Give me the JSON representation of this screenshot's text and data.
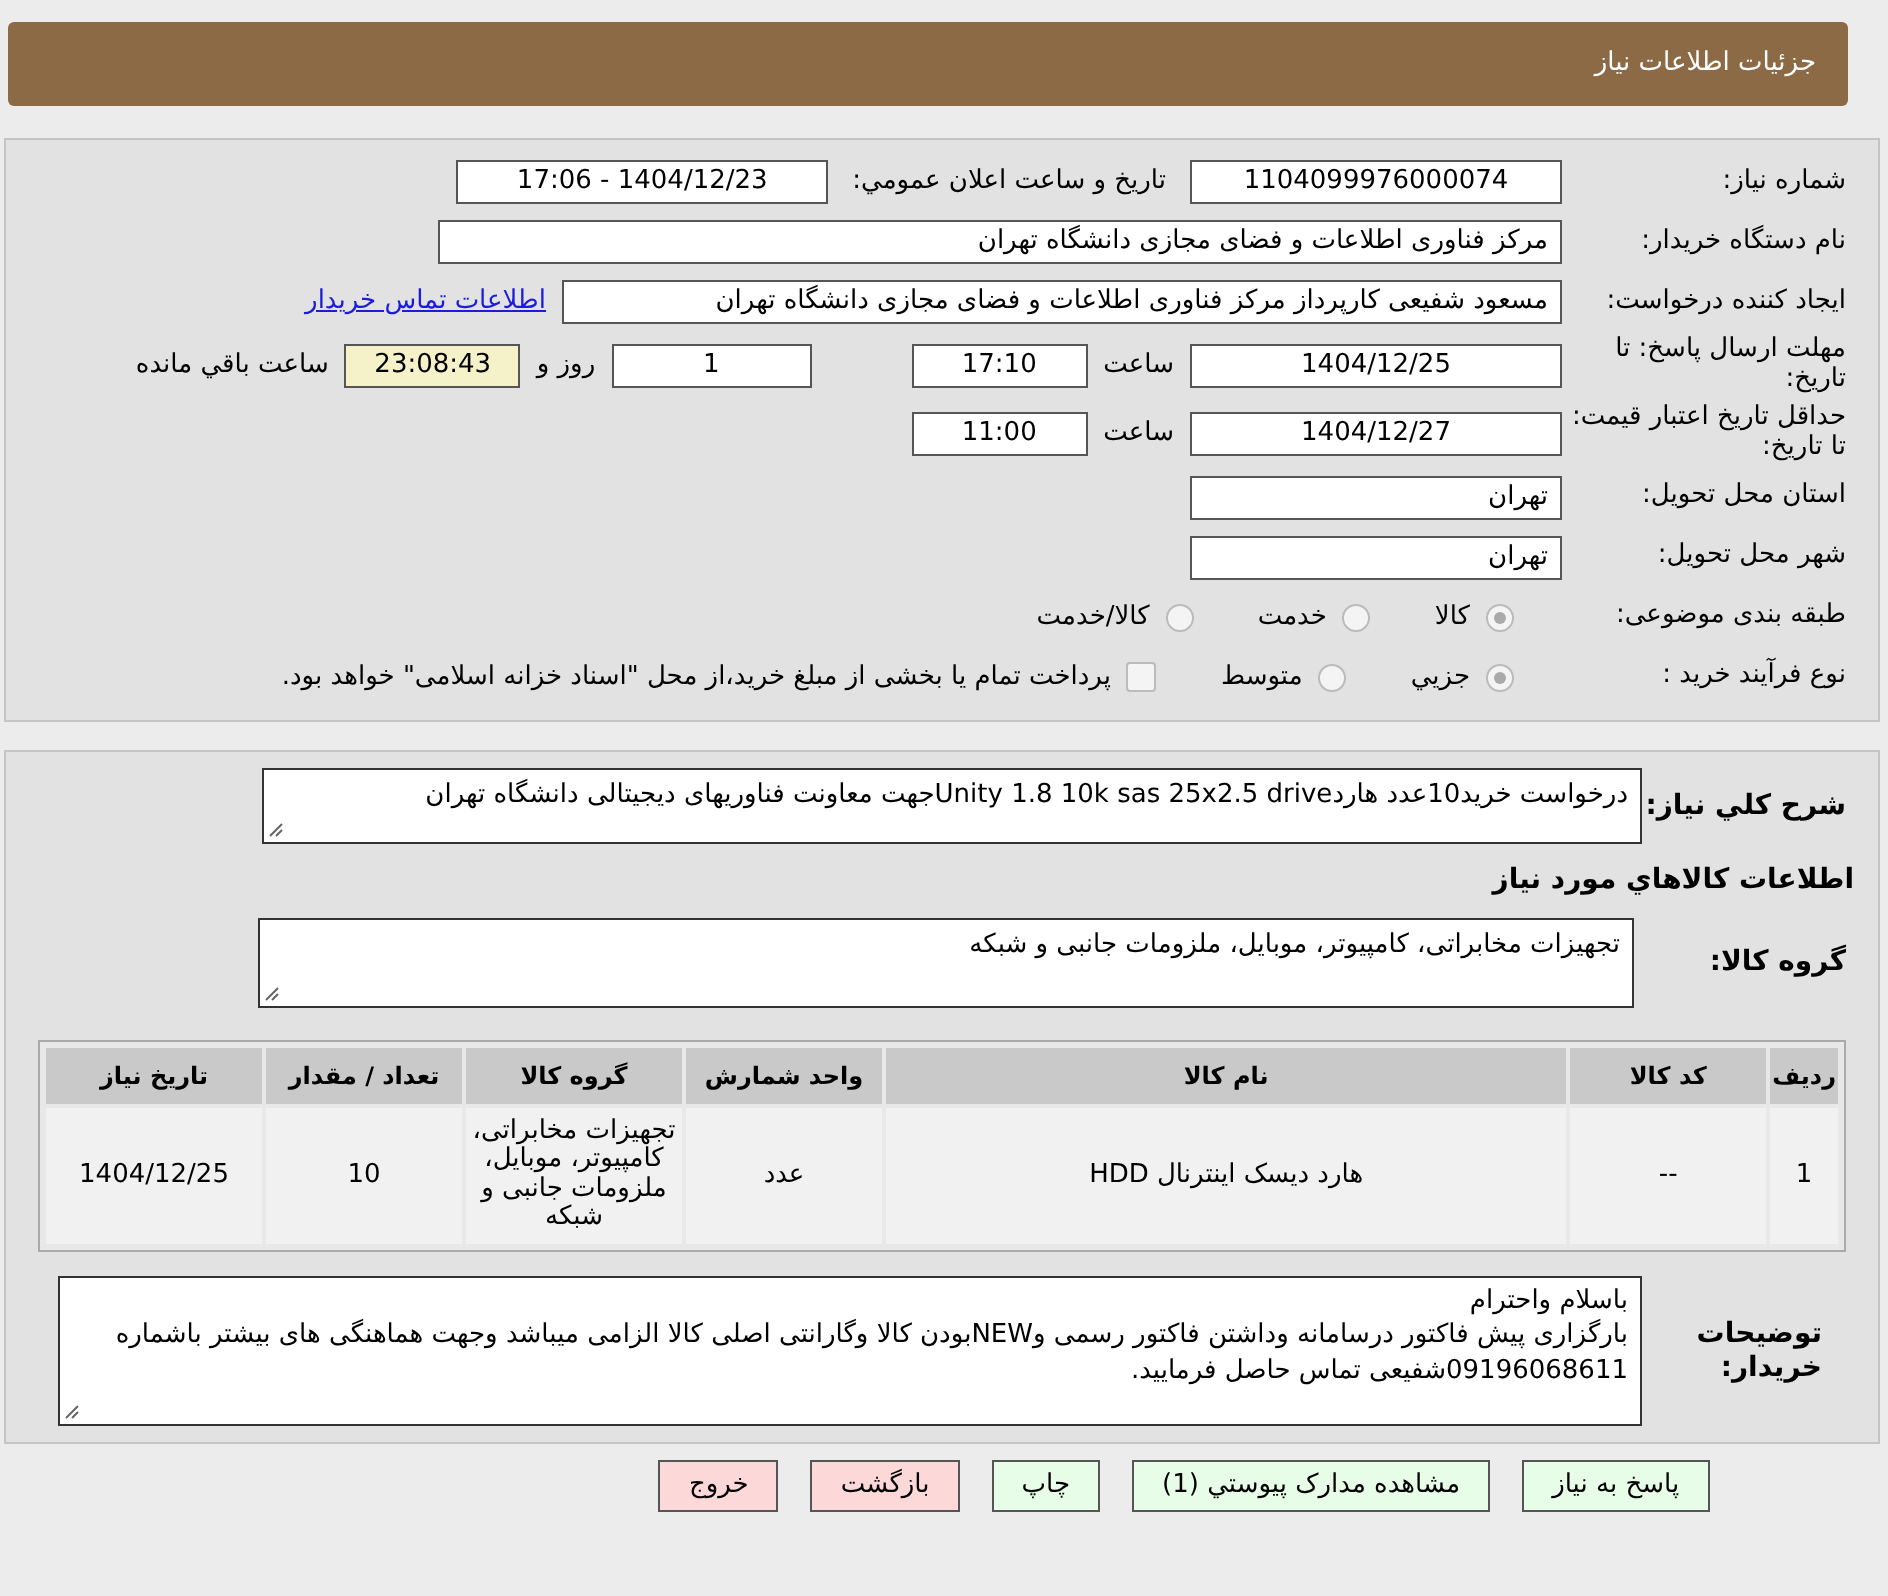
{
  "header": {
    "title": "جزئیات اطلاعات نیاز"
  },
  "need_number": {
    "label": "شماره نیاز:",
    "value": "1104099976000074"
  },
  "announce": {
    "label": "تاریخ و ساعت اعلان عمومي:",
    "value": "1404/12/23 - 17:06"
  },
  "buyer": {
    "label": "نام دستگاه خریدار:",
    "value": "مرکز فناوری اطلاعات و فضای مجازی دانشگاه تهران"
  },
  "creator": {
    "label": "ایجاد کننده درخواست:",
    "value": "مسعود شفیعی کارپرداز مرکز فناوری اطلاعات و فضای مجازی دانشگاه تهران",
    "link": "اطلاعات تماس خریدار"
  },
  "deadline": {
    "label": "مهلت ارسال پاسخ: تا تاریخ:",
    "date": "1404/12/25",
    "time_label": "ساعت",
    "time": "17:10",
    "days": "1",
    "days_label": "روز و",
    "remaining": "23:08:43",
    "remaining_label": "ساعت باقي مانده"
  },
  "validity": {
    "label": "حداقل تاریخ اعتبار قیمت: تا تاریخ:",
    "date": "1404/12/27",
    "time_label": "ساعت",
    "time": "11:00"
  },
  "province": {
    "label": "استان محل تحویل:",
    "value": "تهران"
  },
  "city": {
    "label": "شهر محل تحویل:",
    "value": "تهران"
  },
  "category": {
    "label": "طبقه بندی موضوعی:",
    "options": [
      {
        "label": "کالا",
        "selected": true
      },
      {
        "label": "خدمت",
        "selected": false
      },
      {
        "label": "کالا/خدمت",
        "selected": false
      }
    ]
  },
  "process": {
    "label": "نوع فرآیند خرید :",
    "options": [
      {
        "label": "جزيي",
        "selected": true
      },
      {
        "label": "متوسط",
        "selected": false
      }
    ],
    "treasury": {
      "checked": false,
      "label": "پرداخت تمام یا بخشی از مبلغ خرید،از محل \"اسناد خزانه اسلامی\" خواهد بود."
    }
  },
  "description": {
    "label": "شرح کلي نیاز:",
    "value": "درخواست خرید10عدد هاردUnity 1.8 10k sas 25x2.5 driveجهت معاونت فناوریهای دیجیتالی دانشگاه تهران"
  },
  "goods_title": "اطلاعات کالاهاي مورد نیاز",
  "goods_group": {
    "label": "گروه کالا:",
    "value": "تجهیزات مخابراتی، کامپیوتر، موبایل، ملزومات جانبی و شبکه"
  },
  "table": {
    "columns": [
      "ردیف",
      "کد کالا",
      "نام کالا",
      "واحد شمارش",
      "گروه کالا",
      "تعداد / مقدار",
      "تاریخ نیاز"
    ],
    "rows": [
      [
        "1",
        "--",
        "هارد دیسک اینترنال HDD",
        "عدد",
        "تجهیزات مخابراتی، کامپیوتر، موبایل، ملزومات جانبی و شبکه",
        "10",
        "1404/12/25"
      ]
    ]
  },
  "notes": {
    "label": "توضیحات خریدار:",
    "lines": [
      "باسلام واحترام",
      "بارگزاری پیش فاکتور درسامانه وداشتن فاکتور رسمی وNEWبودن کالا وگارانتی اصلی کالا الزامی میباشد وجهت هماهنگی های بیشتر باشماره 09196068611شفیعی تماس حاصل فرمایید."
    ]
  },
  "buttons": [
    {
      "label": "پاسخ به نیاز",
      "kind": "go"
    },
    {
      "label": "مشاهده مدارک پیوستي (1)",
      "kind": "go"
    },
    {
      "label": "چاپ",
      "kind": "go"
    },
    {
      "label": "بازگشت",
      "kind": "stop"
    },
    {
      "label": "خروج",
      "kind": "stop"
    }
  ]
}
